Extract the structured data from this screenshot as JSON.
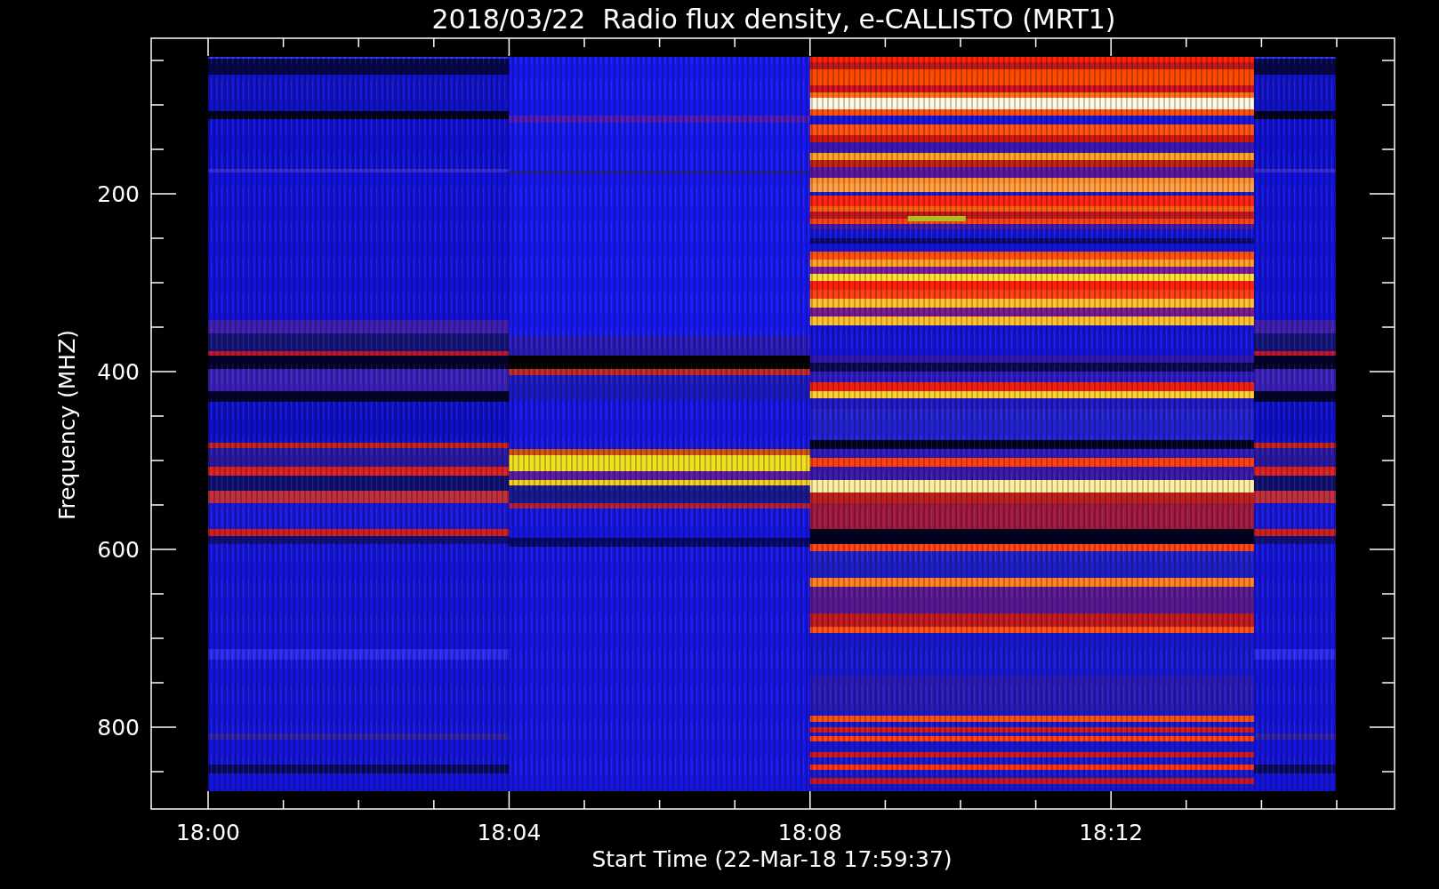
{
  "title": "2018/03/22  Radio flux density, e-CALLISTO (MRT1)",
  "y_axis": {
    "label": "Frequency (MHZ)",
    "tick_labels": [
      "200",
      "400",
      "600",
      "800"
    ]
  },
  "x_axis": {
    "label": "Start Time (22-Mar-18 17:59:37)",
    "tick_labels": [
      "18:00",
      "18:04",
      "18:08",
      "18:12"
    ]
  }
}
